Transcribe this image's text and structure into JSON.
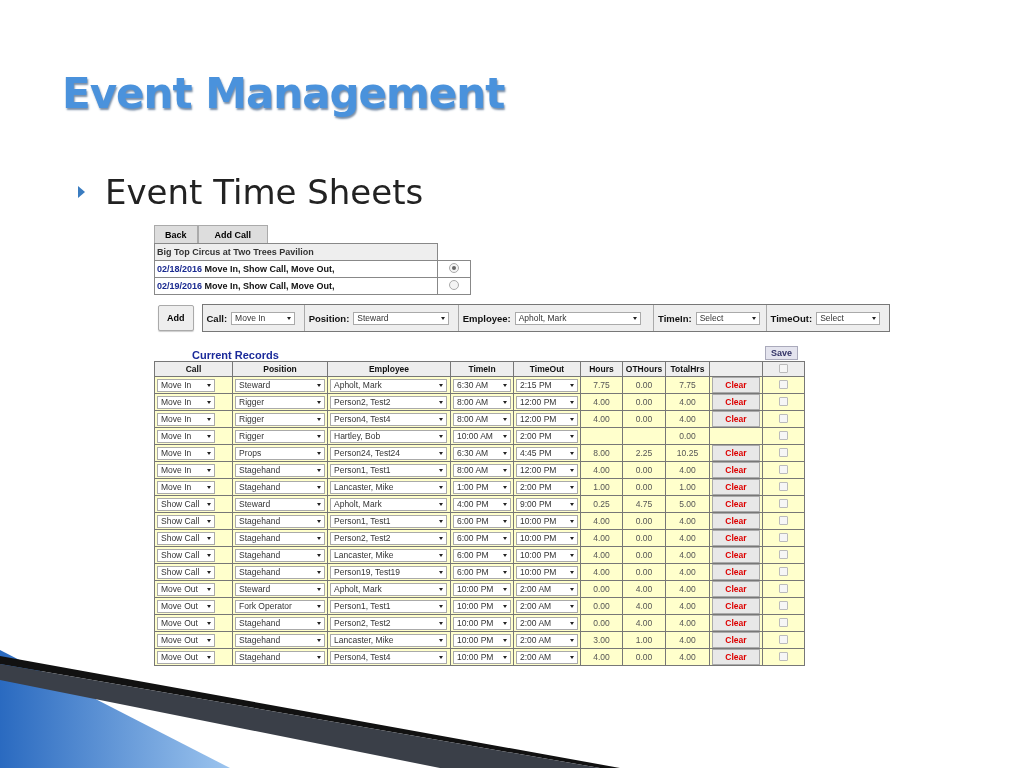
{
  "slide": {
    "title": "Event Management",
    "bullet": "Event Time Sheets"
  },
  "nav_buttons": [
    "Back",
    "Add Call"
  ],
  "event": {
    "name": "Big Top Circus at Two Trees Pavilion",
    "dates": [
      {
        "date": "02/18/2016",
        "calls": "Move In, Show Call, Move Out,",
        "selected": true
      },
      {
        "date": "02/19/2016",
        "calls": "Move In, Show Call, Move Out,",
        "selected": false
      }
    ]
  },
  "filter": {
    "add": "Add",
    "fields": [
      {
        "label": "Call:",
        "value": "Move In"
      },
      {
        "label": "Position:",
        "value": "Steward"
      },
      {
        "label": "Employee:",
        "value": "Apholt, Mark"
      },
      {
        "label": "TimeIn:",
        "value": "Select"
      },
      {
        "label": "TimeOut:",
        "value": "Select"
      }
    ]
  },
  "records": {
    "title": "Current Records",
    "save": "Save",
    "columns": [
      "Call",
      "Position",
      "Employee",
      "TimeIn",
      "TimeOut",
      "Hours",
      "OTHours",
      "TotalHrs"
    ],
    "select_all_checked": false,
    "rows": [
      {
        "call": "Move In",
        "position": "Steward",
        "employee": "Apholt, Mark",
        "time_in": "6:30 AM",
        "time_out": "2:15 PM",
        "hours": "7.75",
        "ot_hours": "0.00",
        "total_hrs": "7.75",
        "clear": "Clear",
        "checked": false
      },
      {
        "call": "Move In",
        "position": "Rigger",
        "employee": "Person2, Test2",
        "time_in": "8:00 AM",
        "time_out": "12:00 PM",
        "hours": "4.00",
        "ot_hours": "0.00",
        "total_hrs": "4.00",
        "clear": "Clear",
        "checked": false
      },
      {
        "call": "Move In",
        "position": "Rigger",
        "employee": "Person4, Test4",
        "time_in": "8:00 AM",
        "time_out": "12:00 PM",
        "hours": "4.00",
        "ot_hours": "0.00",
        "total_hrs": "4.00",
        "clear": "Clear",
        "checked": false
      },
      {
        "call": "Move In",
        "position": "Rigger",
        "employee": "Hartley, Bob",
        "time_in": "10:00 AM",
        "time_out": "2:00 PM",
        "total_hrs": "0.00",
        "checked": false
      },
      {
        "call": "Move In",
        "position": "Props",
        "employee": "Person24, Test24",
        "time_in": "6:30 AM",
        "time_out": "4:45 PM",
        "hours": "8.00",
        "ot_hours": "2.25",
        "total_hrs": "10.25",
        "clear": "Clear",
        "checked": false
      },
      {
        "call": "Move In",
        "position": "Stagehand",
        "employee": "Person1, Test1",
        "time_in": "8:00 AM",
        "time_out": "12:00 PM",
        "hours": "4.00",
        "ot_hours": "0.00",
        "total_hrs": "4.00",
        "clear": "Clear",
        "checked": false
      },
      {
        "call": "Move In",
        "position": "Stagehand",
        "employee": "Lancaster, Mike",
        "time_in": "1:00 PM",
        "time_out": "2:00 PM",
        "hours": "1.00",
        "ot_hours": "0.00",
        "total_hrs": "1.00",
        "clear": "Clear",
        "checked": false
      },
      {
        "call": "Show Call",
        "position": "Steward",
        "employee": "Apholt, Mark",
        "time_in": "4:00 PM",
        "time_out": "9:00 PM",
        "hours": "0.25",
        "ot_hours": "4.75",
        "total_hrs": "5.00",
        "clear": "Clear",
        "checked": false
      },
      {
        "call": "Show Call",
        "position": "Stagehand",
        "employee": "Person1, Test1",
        "time_in": "6:00 PM",
        "time_out": "10:00 PM",
        "hours": "4.00",
        "ot_hours": "0.00",
        "total_hrs": "4.00",
        "clear": "Clear",
        "checked": false
      },
      {
        "call": "Show Call",
        "position": "Stagehand",
        "employee": "Person2, Test2",
        "time_in": "6:00 PM",
        "time_out": "10:00 PM",
        "hours": "4.00",
        "ot_hours": "0.00",
        "total_hrs": "4.00",
        "clear": "Clear",
        "checked": false
      },
      {
        "call": "Show Call",
        "position": "Stagehand",
        "employee": "Lancaster, Mike",
        "time_in": "6:00 PM",
        "time_out": "10:00 PM",
        "hours": "4.00",
        "ot_hours": "0.00",
        "total_hrs": "4.00",
        "clear": "Clear",
        "checked": false
      },
      {
        "call": "Show Call",
        "position": "Stagehand",
        "employee": "Person19, Test19",
        "time_in": "6:00 PM",
        "time_out": "10:00 PM",
        "hours": "4.00",
        "ot_hours": "0.00",
        "total_hrs": "4.00",
        "clear": "Clear",
        "checked": false
      },
      {
        "call": "Move Out",
        "position": "Steward",
        "employee": "Apholt, Mark",
        "time_in": "10:00 PM",
        "time_out": "2:00 AM",
        "hours": "0.00",
        "ot_hours": "4.00",
        "total_hrs": "4.00",
        "clear": "Clear",
        "checked": false
      },
      {
        "call": "Move Out",
        "position": "Fork Operator",
        "employee": "Person1, Test1",
        "time_in": "10:00 PM",
        "time_out": "2:00 AM",
        "hours": "0.00",
        "ot_hours": "4.00",
        "total_hrs": "4.00",
        "clear": "Clear",
        "checked": false
      },
      {
        "call": "Move Out",
        "position": "Stagehand",
        "employee": "Person2, Test2",
        "time_in": "10:00 PM",
        "time_out": "2:00 AM",
        "hours": "0.00",
        "ot_hours": "4.00",
        "total_hrs": "4.00",
        "clear": "Clear",
        "checked": false
      },
      {
        "call": "Move Out",
        "position": "Stagehand",
        "employee": "Lancaster, Mike",
        "time_in": "10:00 PM",
        "time_out": "2:00 AM",
        "hours": "3.00",
        "ot_hours": "1.00",
        "total_hrs": "4.00",
        "clear": "Clear",
        "checked": false
      },
      {
        "call": "Move Out",
        "position": "Stagehand",
        "employee": "Person4, Test4",
        "time_in": "10:00 PM",
        "time_out": "2:00 AM",
        "hours": "4.00",
        "ot_hours": "0.00",
        "total_hrs": "4.00",
        "clear": "Clear",
        "checked": false
      }
    ]
  }
}
